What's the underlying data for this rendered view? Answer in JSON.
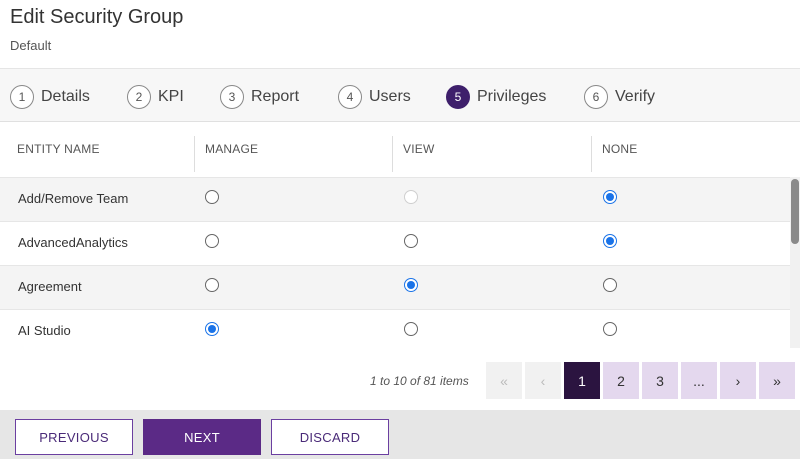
{
  "header": {
    "title": "Edit Security Group",
    "subtitle": "Default"
  },
  "steps": [
    {
      "num": "1",
      "label": "Details",
      "active": false
    },
    {
      "num": "2",
      "label": "KPI",
      "active": false
    },
    {
      "num": "3",
      "label": "Report",
      "active": false
    },
    {
      "num": "4",
      "label": "Users",
      "active": false
    },
    {
      "num": "5",
      "label": "Privileges",
      "active": true
    },
    {
      "num": "6",
      "label": "Verify",
      "active": false
    }
  ],
  "table": {
    "columns": [
      "ENTITY NAME",
      "MANAGE",
      "VIEW",
      "NONE"
    ],
    "rows": [
      {
        "name": "Add/Remove Team",
        "selected": "none",
        "view_disabled": true
      },
      {
        "name": "AdvancedAnalytics",
        "selected": "none",
        "view_disabled": false
      },
      {
        "name": "Agreement",
        "selected": "view",
        "view_disabled": false
      },
      {
        "name": "AI Studio",
        "selected": "manage",
        "view_disabled": false
      }
    ]
  },
  "pagination": {
    "info": "1 to 10 of 81 items",
    "first": "«",
    "prev": "‹",
    "pages": [
      "1",
      "2",
      "3",
      "..."
    ],
    "current_page": "1",
    "next": "›",
    "last": "»"
  },
  "footer": {
    "previous": "PREVIOUS",
    "next": "NEXT",
    "discard": "DISCARD"
  },
  "colors": {
    "brand": "#5b2a86",
    "active_step": "#3e1f6b",
    "radio_checked": "#1a73e8"
  }
}
